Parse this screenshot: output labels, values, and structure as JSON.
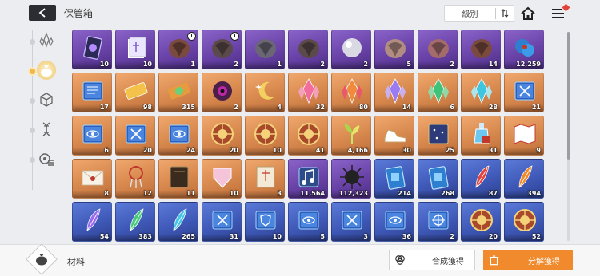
{
  "header": {
    "title": "保管箱",
    "sort_label": "級別",
    "icons": [
      "back-arrow-icon",
      "sort-toggle-icon",
      "home-icon",
      "menu-icon"
    ]
  },
  "sidebar": {
    "items": [
      {
        "icon": "crystal-cluster-icon",
        "active": false
      },
      {
        "icon": "material-pouch-icon",
        "active": true
      },
      {
        "icon": "cube-icon",
        "active": false
      },
      {
        "icon": "dna-icon",
        "active": false
      },
      {
        "icon": "gear-list-icon",
        "active": false
      }
    ]
  },
  "colors": {
    "purple": "#6a43a8",
    "gold": "#d98a4f",
    "blue": "#3f59b8",
    "accent_orange": "#f08a2d"
  },
  "grid": {
    "rows": [
      [
        {
          "rarity": "purple",
          "icon": "card-icon",
          "qty": "10"
        },
        {
          "rarity": "purple",
          "icon": "paper-stack-icon",
          "qty": "10"
        },
        {
          "rarity": "purple",
          "icon": "red-core-icon",
          "qty": "1",
          "timer": true
        },
        {
          "rarity": "purple",
          "icon": "dark-core-icon",
          "qty": "2",
          "timer": true
        },
        {
          "rarity": "purple",
          "icon": "mask-core-icon",
          "qty": "1"
        },
        {
          "rarity": "purple",
          "icon": "dark-core-icon",
          "qty": "2"
        },
        {
          "rarity": "purple",
          "icon": "silver-orb-icon",
          "qty": "2"
        },
        {
          "rarity": "purple",
          "icon": "skull-core-icon",
          "qty": "5"
        },
        {
          "rarity": "purple",
          "icon": "flesh-core-icon",
          "qty": "2"
        },
        {
          "rarity": "purple",
          "icon": "red-core-icon",
          "qty": "14"
        },
        {
          "rarity": "purple",
          "icon": "blue-mass-icon",
          "qty": "12,259"
        }
      ],
      [
        {
          "rarity": "gold",
          "icon": "blue-book-icon",
          "qty": "17"
        },
        {
          "rarity": "gold",
          "icon": "gold-ticket-icon",
          "qty": "98"
        },
        {
          "rarity": "gold",
          "icon": "flower-ticket-icon",
          "qty": "315"
        },
        {
          "rarity": "gold",
          "icon": "purple-eye-icon",
          "qty": "2"
        },
        {
          "rarity": "gold",
          "icon": "moon-sparkle-icon",
          "qty": "4"
        },
        {
          "rarity": "gold",
          "icon": "pink-crystal-icon",
          "qty": "32"
        },
        {
          "rarity": "gold",
          "icon": "orange-crystal-icon",
          "qty": "80"
        },
        {
          "rarity": "gold",
          "icon": "purple-crystal-icon",
          "qty": "14"
        },
        {
          "rarity": "gold",
          "icon": "green-crystal-icon",
          "qty": "6"
        },
        {
          "rarity": "gold",
          "icon": "cyan-crystal-icon",
          "qty": "28"
        },
        {
          "rarity": "gold",
          "icon": "sword-book-icon",
          "qty": "21"
        }
      ],
      [
        {
          "rarity": "gold",
          "icon": "eye-book-icon",
          "qty": "6"
        },
        {
          "rarity": "gold",
          "icon": "sword-book-icon",
          "qty": "20"
        },
        {
          "rarity": "gold",
          "icon": "eye-book-icon",
          "qty": "24"
        },
        {
          "rarity": "gold",
          "icon": "sun-medal-icon",
          "qty": "20"
        },
        {
          "rarity": "gold",
          "icon": "sun-medal-icon",
          "qty": "10"
        },
        {
          "rarity": "gold",
          "icon": "sun-medal-icon",
          "qty": "41"
        },
        {
          "rarity": "gold",
          "icon": "sprout-icon",
          "qty": "4,166"
        },
        {
          "rarity": "gold",
          "icon": "sneakers-icon",
          "qty": "30"
        },
        {
          "rarity": "gold",
          "icon": "star-book-icon",
          "qty": "25"
        },
        {
          "rarity": "gold",
          "icon": "potion-icon",
          "qty": "31"
        },
        {
          "rarity": "gold",
          "icon": "folded-map-icon",
          "qty": "9"
        }
      ],
      [
        {
          "rarity": "gold",
          "icon": "envelope-icon",
          "qty": "8"
        },
        {
          "rarity": "gold",
          "icon": "dreamcatcher-icon",
          "qty": "12"
        },
        {
          "rarity": "gold",
          "icon": "leather-book-icon",
          "qty": "11"
        },
        {
          "rarity": "gold",
          "icon": "pink-plate-icon",
          "qty": "10"
        },
        {
          "rarity": "gold",
          "icon": "scroll-icon",
          "qty": "3"
        },
        {
          "rarity": "purple",
          "icon": "music-note-icon",
          "qty": "11,564"
        },
        {
          "rarity": "purple",
          "icon": "spiky-orb-icon",
          "qty": "112,323"
        },
        {
          "rarity": "blue",
          "icon": "blue-card-icon",
          "qty": "214"
        },
        {
          "rarity": "blue",
          "icon": "blue-card-icon",
          "qty": "268"
        },
        {
          "rarity": "blue",
          "icon": "red-feather-icon",
          "qty": "87"
        },
        {
          "rarity": "blue",
          "icon": "orange-feather-icon",
          "qty": "394"
        }
      ],
      [
        {
          "rarity": "blue",
          "icon": "purple-feather-icon",
          "qty": "54"
        },
        {
          "rarity": "blue",
          "icon": "green-feather-icon",
          "qty": "383"
        },
        {
          "rarity": "blue",
          "icon": "cyan-feather-icon",
          "qty": "265"
        },
        {
          "rarity": "blue",
          "icon": "sword-book-icon",
          "qty": "31"
        },
        {
          "rarity": "blue",
          "icon": "shield-book-icon",
          "qty": "10"
        },
        {
          "rarity": "blue",
          "icon": "eye-book-icon",
          "qty": "5"
        },
        {
          "rarity": "blue",
          "icon": "sword-book-icon",
          "qty": "3"
        },
        {
          "rarity": "blue",
          "icon": "eye-book-icon",
          "qty": "36"
        },
        {
          "rarity": "blue",
          "icon": "target-book-icon",
          "qty": "2"
        },
        {
          "rarity": "blue",
          "icon": "sun-medal-icon",
          "qty": "20"
        },
        {
          "rarity": "blue",
          "icon": "sun-medal-icon",
          "qty": "52"
        }
      ]
    ]
  },
  "footer": {
    "category_label": "材料",
    "combine_label": "合成獲得",
    "decompose_label": "分解獲得"
  }
}
